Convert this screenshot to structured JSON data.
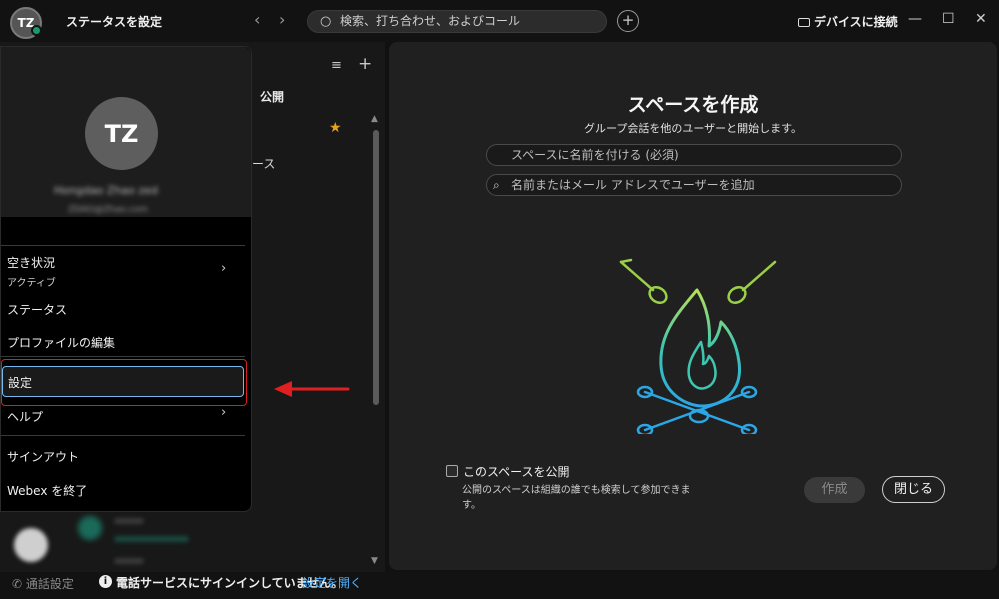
{
  "header": {
    "avatar_initials": "TZ",
    "status_label": "ステータスを設定",
    "back_arrow": "‹",
    "forward_arrow": "›",
    "search_icon": "○",
    "search_placeholder": "検索、打ち合わせ、およびコール",
    "add_symbol": "+",
    "connect_device": "デバイスに接続",
    "minimize": "—",
    "maximize": "☐",
    "close": "✕"
  },
  "spaces_list": {
    "filter_icon": "≡",
    "add_icon": "+",
    "public_tab": "公開",
    "star_glyph": "★",
    "partial_text": "ース",
    "scroll_up_glyph": "▲",
    "scroll_down_glyph": "▼"
  },
  "profile_menu": {
    "initials": "TZ",
    "name_blurred": "Hongdao Zhao zed",
    "email_blurred": "ZDAO@Zhao.com",
    "availability_label": "空き状況",
    "availability_value": "アクティブ",
    "status_item": "ステータス",
    "edit_profile": "プロファイルの編集",
    "settings": "設定",
    "help": "ヘルプ",
    "sign_out": "サインアウト",
    "quit": "Webex を終了",
    "chevron": "›"
  },
  "create_space": {
    "title": "スペースを作成",
    "subtitle": "グループ会話を他のユーザーと開始します。",
    "name_placeholder": "スペースに名前を付ける (必須)",
    "people_placeholder": "名前またはメール アドレスでユーザーを追加",
    "public_label": "このスペースを公開",
    "public_desc": "公開のスペースは組織の誰でも検索して参加できます。",
    "create_button": "作成",
    "close_button": "閉じる",
    "search_glyph": "⌕"
  },
  "bottom_bar": {
    "call_settings": "通話設定",
    "info_glyph": "i",
    "phone_message": "電話サービスにサインインしていません。",
    "open_settings": "設定を開く"
  },
  "colors": {
    "accent_blue": "#4fb3ff",
    "highlight_red": "#d52020",
    "focus_blue": "#7ab8f0",
    "star": "#e8a317",
    "presence": "#1a9a6a"
  }
}
